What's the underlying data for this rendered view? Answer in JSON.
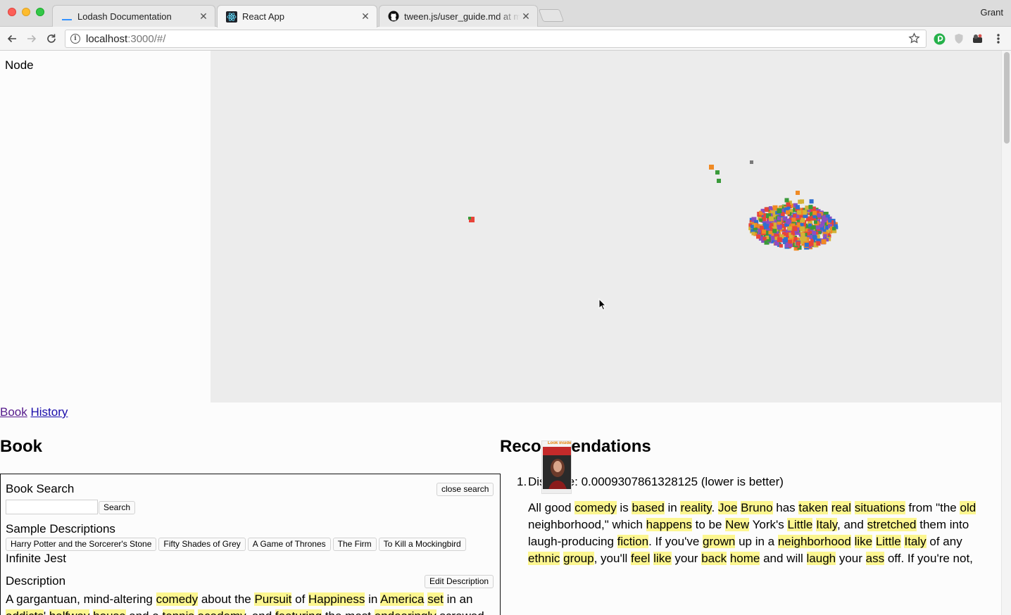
{
  "browser": {
    "tabs": [
      {
        "title": "Lodash Documentation",
        "icon": "lodash-icon",
        "active": false
      },
      {
        "title": "React App",
        "icon": "react-icon",
        "active": true
      },
      {
        "title": "tween.js/user_guide.md at mas",
        "icon": "github-icon",
        "active": false
      }
    ],
    "profile": "Grant",
    "url_host": "localhost",
    "url_rest": ":3000/#/"
  },
  "node_panel": {
    "label": "Node"
  },
  "nav_links": {
    "book": "Book",
    "history": "History"
  },
  "book": {
    "heading": "Book",
    "search_title": "Book Search",
    "close_search": "close search",
    "search_button": "Search",
    "search_value": "",
    "samples_title": "Sample Descriptions",
    "samples": [
      "Harry Potter and the Sorcerer's Stone",
      "Fifty Shades of Grey",
      "A Game of Thrones",
      "The Firm",
      "To Kill a Mockingbird"
    ],
    "selected_title": "Infinite Jest",
    "description_title": "Description",
    "edit_description": "Edit Description",
    "description_segments": [
      {
        "t": "A gargantuan, mind-altering ",
        "h": false
      },
      {
        "t": "comedy",
        "h": true
      },
      {
        "t": " about the ",
        "h": false
      },
      {
        "t": "Pursuit",
        "h": true
      },
      {
        "t": " of ",
        "h": false
      },
      {
        "t": "Happiness",
        "h": true
      },
      {
        "t": " in ",
        "h": false
      },
      {
        "t": "America",
        "h": true
      },
      {
        "t": " ",
        "h": false
      },
      {
        "t": "set",
        "h": true
      },
      {
        "t": " in an ",
        "h": false
      },
      {
        "t": "addicts",
        "h": true
      },
      {
        "t": "' ",
        "h": false
      },
      {
        "t": "halfway",
        "h": true
      },
      {
        "t": " ",
        "h": false
      },
      {
        "t": "house",
        "h": true
      },
      {
        "t": " and a ",
        "h": false
      },
      {
        "t": "tennis",
        "h": true
      },
      {
        "t": " ",
        "h": false
      },
      {
        "t": "academy",
        "h": true
      },
      {
        "t": ", and ",
        "h": false
      },
      {
        "t": "featuring",
        "h": true
      },
      {
        "t": " the most ",
        "h": false
      },
      {
        "t": "endearingly",
        "h": true
      },
      {
        "t": " screwed-",
        "h": false
      }
    ]
  },
  "recommendations": {
    "heading": "Recommendations",
    "items": [
      {
        "number": "1.",
        "distance_text": "Distance: 0.0009307861328125 (lower is better)",
        "cover_caption": "Look inside",
        "description_segments": [
          {
            "t": "All good ",
            "h": false
          },
          {
            "t": "comedy",
            "h": true
          },
          {
            "t": " is ",
            "h": false
          },
          {
            "t": "based",
            "h": true
          },
          {
            "t": " in ",
            "h": false
          },
          {
            "t": "reality",
            "h": true
          },
          {
            "t": ". ",
            "h": false
          },
          {
            "t": "Joe",
            "h": true
          },
          {
            "t": " ",
            "h": false
          },
          {
            "t": "Bruno",
            "h": true
          },
          {
            "t": " has ",
            "h": false
          },
          {
            "t": "taken",
            "h": true
          },
          {
            "t": " ",
            "h": false
          },
          {
            "t": "real",
            "h": true
          },
          {
            "t": " ",
            "h": false
          },
          {
            "t": "situations",
            "h": true
          },
          {
            "t": " from \"the ",
            "h": false
          },
          {
            "t": "old",
            "h": true
          },
          {
            "t": " neighborhood,\" which ",
            "h": false
          },
          {
            "t": "happens",
            "h": true
          },
          {
            "t": " to be ",
            "h": false
          },
          {
            "t": "New",
            "h": true
          },
          {
            "t": " York's ",
            "h": false
          },
          {
            "t": "Little",
            "h": true
          },
          {
            "t": " ",
            "h": false
          },
          {
            "t": "Italy",
            "h": true
          },
          {
            "t": ", and ",
            "h": false
          },
          {
            "t": "stretched",
            "h": true
          },
          {
            "t": " them into laugh-producing ",
            "h": false
          },
          {
            "t": "fiction",
            "h": true
          },
          {
            "t": ". If you've ",
            "h": false
          },
          {
            "t": "grown",
            "h": true
          },
          {
            "t": " up in a ",
            "h": false
          },
          {
            "t": "neighborhood",
            "h": true
          },
          {
            "t": " ",
            "h": false
          },
          {
            "t": "like",
            "h": true
          },
          {
            "t": " ",
            "h": false
          },
          {
            "t": "Little",
            "h": true
          },
          {
            "t": " ",
            "h": false
          },
          {
            "t": "Italy",
            "h": true
          },
          {
            "t": " of any ",
            "h": false
          },
          {
            "t": "ethnic",
            "h": true
          },
          {
            "t": " ",
            "h": false
          },
          {
            "t": "group",
            "h": true
          },
          {
            "t": ", you'll ",
            "h": false
          },
          {
            "t": "feel",
            "h": true
          },
          {
            "t": " ",
            "h": false
          },
          {
            "t": "like",
            "h": true
          },
          {
            "t": " your ",
            "h": false
          },
          {
            "t": "back",
            "h": true
          },
          {
            "t": " ",
            "h": false
          },
          {
            "t": "home",
            "h": true
          },
          {
            "t": " and will ",
            "h": false
          },
          {
            "t": "laugh",
            "h": true
          },
          {
            "t": " your ",
            "h": false
          },
          {
            "t": "ass",
            "h": true
          },
          {
            "t": " off.  If you're not,",
            "h": false
          }
        ]
      }
    ]
  },
  "colors": {
    "highlight": "#fcf690",
    "viz_background": "#ececec",
    "link": "#1a0dab",
    "link_visited": "#551a8b",
    "cluster_palette": [
      "#e8443a",
      "#f08a24",
      "#3a9a3a",
      "#2f6fd0",
      "#8a4fc4",
      "#d4b236",
      "#7a7a7a"
    ]
  }
}
